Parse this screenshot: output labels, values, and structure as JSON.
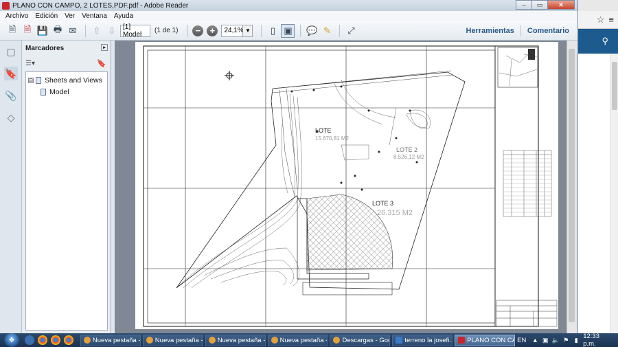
{
  "window": {
    "title": "PLANO CON CAMPO, 2 LOTES,PDF.pdf - Adobe Reader",
    "controls": [
      "–",
      "▭",
      "✕"
    ]
  },
  "menu": [
    "Archivo",
    "Edición",
    "Ver",
    "Ventana",
    "Ayuda"
  ],
  "toolbar": {
    "page_value": "[1] Model",
    "page_of": "(1 de 1)",
    "zoom_value": "24,1%",
    "tools_link": "Herramientas",
    "comment_link": "Comentario"
  },
  "bookmarks": {
    "title": "Marcadores",
    "options_glyph": "☰▾",
    "tree": [
      {
        "label": "Sheets and Views",
        "expander": "⊟"
      },
      {
        "label": "Model"
      }
    ]
  },
  "plan": {
    "lot1_name": "LOTE",
    "lot1_area": "15.670,81 M2",
    "lot2_name": "LOTE 2",
    "lot2_area": "8.526,12 M2",
    "lot3_name": "LOTE 3",
    "lot3_area": "26.315  M2"
  },
  "taskbar": {
    "tasks": [
      {
        "label": "Nueva pestaña -...",
        "active": false
      },
      {
        "label": "Nueva pestaña -...",
        "active": false
      },
      {
        "label": "Nueva pestaña -...",
        "active": false
      },
      {
        "label": "Nueva pestaña -...",
        "active": false
      },
      {
        "label": "Descargas - Goo...",
        "active": false
      },
      {
        "label": "terreno la josefi...",
        "active": false
      },
      {
        "label": "PLANO CON CA...",
        "active": true
      }
    ],
    "language": "EN",
    "clock": "12:33 p.m."
  }
}
